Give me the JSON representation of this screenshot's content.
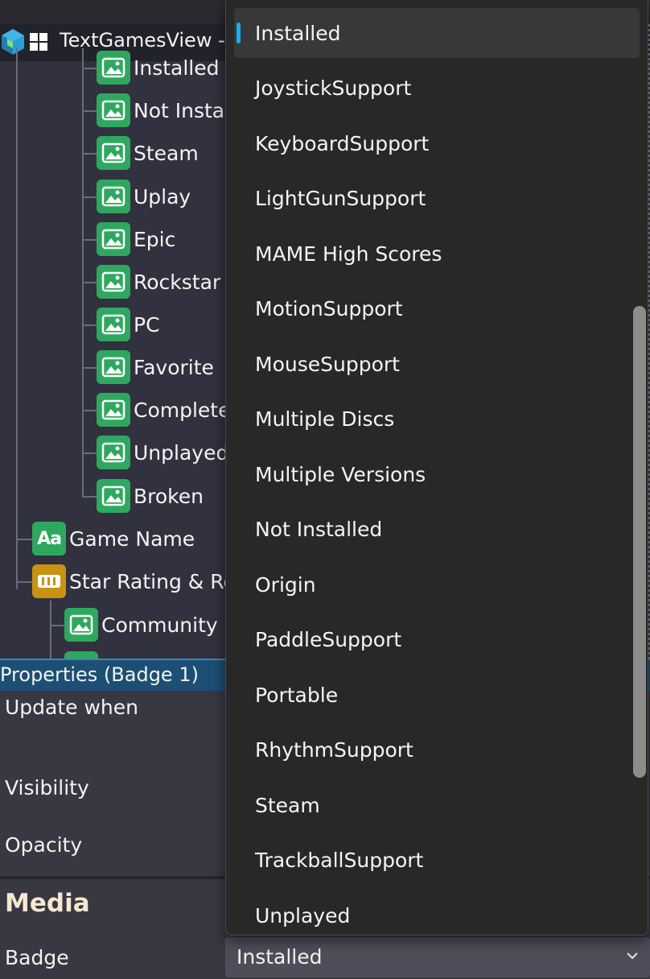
{
  "window": {
    "title": "TextGamesView -",
    "app_icon": "cube-app-icon",
    "os_icon": "windows-logo-icon"
  },
  "tree": {
    "items": [
      {
        "label": "Installed",
        "icon": "image-badge-icon"
      },
      {
        "label": "Not Instal",
        "icon": "image-badge-icon"
      },
      {
        "label": "Steam",
        "icon": "image-badge-icon"
      },
      {
        "label": "Uplay",
        "icon": "image-badge-icon"
      },
      {
        "label": "Epic",
        "icon": "image-badge-icon"
      },
      {
        "label": "Rockstar",
        "icon": "image-badge-icon"
      },
      {
        "label": "PC",
        "icon": "image-badge-icon"
      },
      {
        "label": "Favorite",
        "icon": "image-badge-icon"
      },
      {
        "label": "Complete",
        "icon": "image-badge-icon"
      },
      {
        "label": "Unplayed",
        "icon": "image-badge-icon"
      },
      {
        "label": "Broken",
        "icon": "image-badge-icon"
      },
      {
        "label": "Game Name",
        "icon": "text-aa-icon"
      },
      {
        "label": "Star Rating & Re",
        "icon": "rating-bars-icon"
      },
      {
        "label": "Community S",
        "icon": "image-badge-icon"
      }
    ]
  },
  "properties": {
    "header": "Properties (Badge 1)",
    "update_when_label": "Update when",
    "visibility_label": "Visibility",
    "opacity_label": "Opacity",
    "section_media": "Media",
    "badge_label": "Badge",
    "badge_value": "Installed"
  },
  "dropdown": {
    "selected_index": 0,
    "options": [
      "Installed",
      "JoystickSupport",
      "KeyboardSupport",
      "LightGunSupport",
      "MAME High Scores",
      "MotionSupport",
      "MouseSupport",
      "Multiple Discs",
      "Multiple Versions",
      "Not Installed",
      "Origin",
      "PaddleSupport",
      "Portable",
      "RhythmSupport",
      "Steam",
      "TrackballSupport",
      "Unplayed"
    ]
  },
  "colors": {
    "tree_icon_green": "#2fa85f",
    "tree_icon_gold": "#c89213",
    "header_blue": "#1d4f74",
    "selection_accent": "#12b0f2",
    "popup_bg": "#282828",
    "media_heading": "#f6e7cf"
  }
}
